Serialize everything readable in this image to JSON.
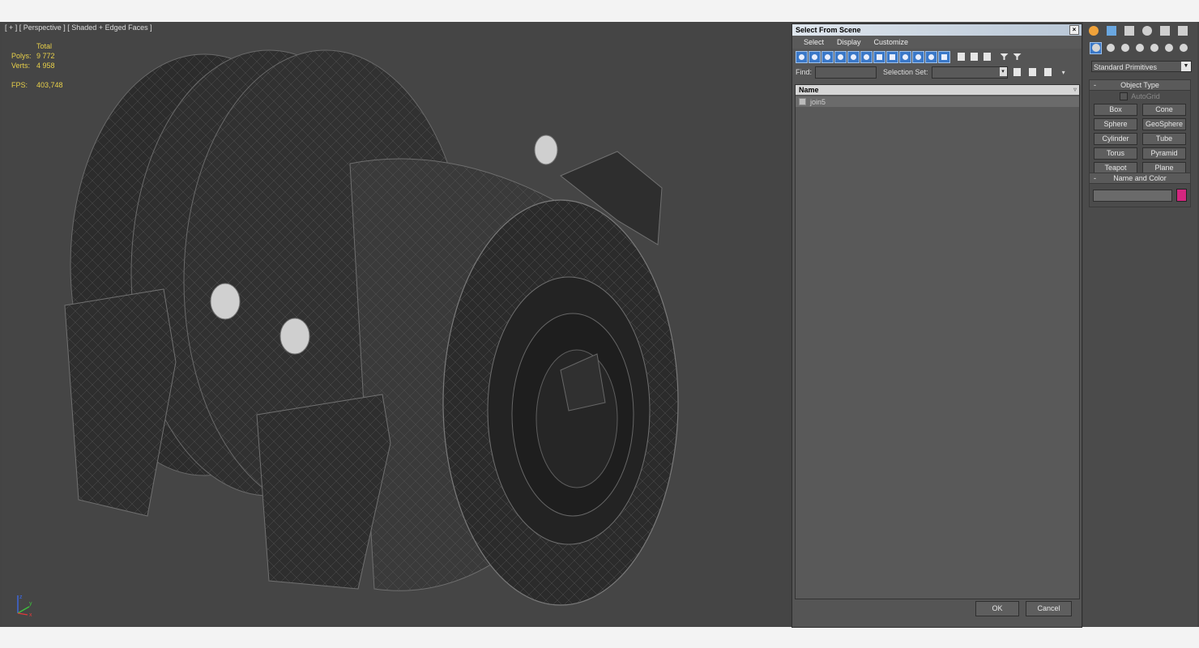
{
  "viewport": {
    "label": "[ + ] [ Perspective ] [ Shaded + Edged Faces ]",
    "stats": {
      "total_label": "Total",
      "polys_label": "Polys:",
      "polys_value": "9 772",
      "verts_label": "Verts:",
      "verts_value": "4 958",
      "fps_label": "FPS:",
      "fps_value": "403,748"
    },
    "axis_labels": {
      "x": "x",
      "y": "y",
      "z": "z"
    }
  },
  "select_dialog": {
    "title": "Select From Scene",
    "close_glyph": "×",
    "menu": [
      "Select",
      "Display",
      "Customize"
    ],
    "find_label": "Find:",
    "find_value": "",
    "selection_set_label": "Selection Set:",
    "selection_set_value": "",
    "column_name": "Name",
    "rows": [
      "join5"
    ],
    "ok_label": "OK",
    "cancel_label": "Cancel"
  },
  "command_panel": {
    "dropdown_value": "Standard Primitives",
    "object_type": {
      "title": "Object Type",
      "collapse_glyph": "-",
      "autogrid_label": "AutoGrid",
      "autogrid_checked": false,
      "buttons": [
        "Box",
        "Cone",
        "Sphere",
        "GeoSphere",
        "Cylinder",
        "Tube",
        "Torus",
        "Pyramid",
        "Teapot",
        "Plane"
      ]
    },
    "name_and_color": {
      "title": "Name and Color",
      "collapse_glyph": "-",
      "name_value": "",
      "color": "#d4267f"
    }
  }
}
